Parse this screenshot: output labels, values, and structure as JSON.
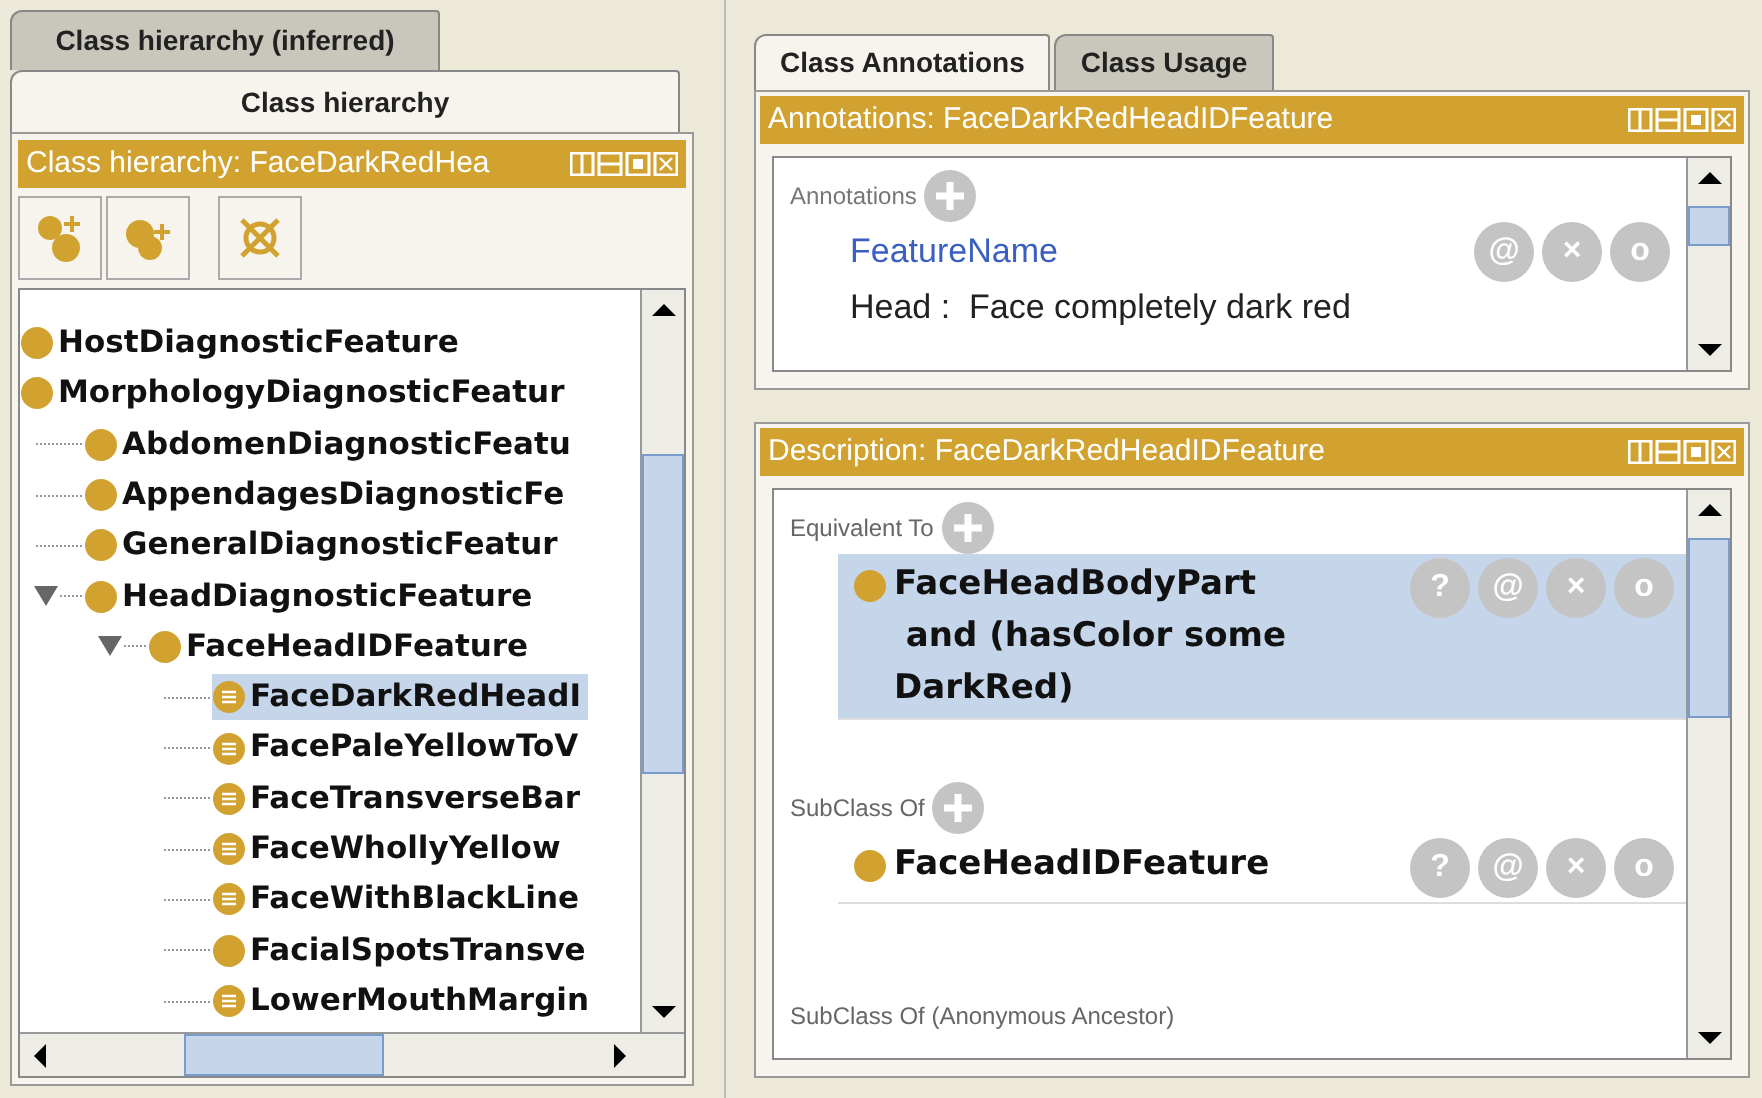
{
  "left_tabs": [
    {
      "label": "Class hierarchy (inferred)",
      "selected": false
    },
    {
      "label": "Class hierarchy",
      "selected": true
    }
  ],
  "hierarchy_panel": {
    "title": "Class hierarchy: FaceDarkRedHea",
    "tree": [
      {
        "name": "HostDiagnosticFeature",
        "kind": "primitive",
        "selected": false
      },
      {
        "name": "MorphologyDiagnosticFeatur",
        "kind": "primitive",
        "selected": false,
        "children": [
          {
            "name": "AbdomenDiagnosticFeatu",
            "kind": "primitive",
            "selected": false
          },
          {
            "name": "AppendagesDiagnosticFe",
            "kind": "primitive",
            "selected": false
          },
          {
            "name": "GeneralDiagnosticFeatur",
            "kind": "primitive",
            "selected": false
          },
          {
            "name": "HeadDiagnosticFeature",
            "kind": "primitive",
            "selected": false,
            "expanded": true,
            "children": [
              {
                "name": "FaceHeadIDFeature",
                "kind": "primitive",
                "selected": false,
                "expanded": true,
                "children": [
                  {
                    "name": "FaceDarkRedHeadI",
                    "kind": "defined",
                    "selected": true
                  },
                  {
                    "name": "FacePaleYellowToV",
                    "kind": "defined",
                    "selected": false
                  },
                  {
                    "name": "FaceTransverseBar",
                    "kind": "defined",
                    "selected": false
                  },
                  {
                    "name": "FaceWhollyYellow",
                    "kind": "defined",
                    "selected": false
                  },
                  {
                    "name": "FaceWithBlackLine",
                    "kind": "defined",
                    "selected": false
                  },
                  {
                    "name": "FacialSpotsTransve",
                    "kind": "primitive",
                    "selected": false
                  },
                  {
                    "name": "LowerMouthMargin",
                    "kind": "defined",
                    "selected": false
                  }
                ]
              }
            ]
          }
        ]
      }
    ]
  },
  "right_tabs": [
    {
      "label": "Class Annotations",
      "selected": true
    },
    {
      "label": "Class Usage",
      "selected": false
    }
  ],
  "annotations_panel": {
    "title": "Annotations: FaceDarkRedHeadIDFeature",
    "section": "Annotations",
    "items": [
      {
        "property": "FeatureName",
        "value": "Head :  Face completely dark red",
        "buttons": [
          "@",
          "×",
          "o"
        ]
      }
    ]
  },
  "description_panel": {
    "title": "Description: FaceDarkRedHeadIDFeature",
    "sections": [
      {
        "label": "Equivalent To",
        "items": [
          {
            "lines": [
              "FaceHeadBodyPart",
              " and (hasColor some",
              "DarkRed)"
            ],
            "selected": true,
            "buttons": [
              "?",
              "@",
              "×",
              "o"
            ]
          }
        ]
      },
      {
        "label": "SubClass Of",
        "items": [
          {
            "lines": [
              "FaceHeadIDFeature"
            ],
            "selected": false,
            "buttons": [
              "?",
              "@",
              "×",
              "o"
            ]
          }
        ]
      },
      {
        "label": "SubClass Of (Anonymous Ancestor)"
      }
    ]
  }
}
